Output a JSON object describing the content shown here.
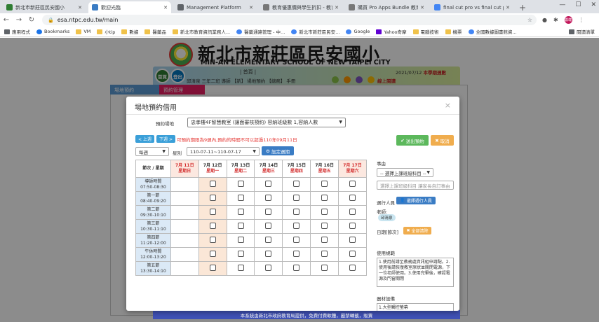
{
  "browser": {
    "tabs": [
      {
        "title": "新北市新莊區民安國小",
        "color": "#2e7d32"
      },
      {
        "title": "歡迎光臨",
        "color": "#3a7cc4",
        "active": true
      },
      {
        "title": "Management Platform",
        "color": "#5f6368"
      },
      {
        "title": "教育優惠價與學生折扣 - 教育...",
        "color": "#777"
      },
      {
        "title": "購買 Pro Apps Bundle 教育...",
        "color": "#777"
      },
      {
        "title": "final cut pro vs final cut pro...",
        "color": "#4285f4"
      }
    ],
    "new_tab": "+",
    "url": "esa.ntpc.edu.tw/main",
    "avatar_text": "雲端",
    "bookmarks": [
      "應用程式",
      "Bookmarks",
      "VM",
      "小tip",
      "數據",
      "醫藥品",
      "新北市教育資訊業務人...",
      "醫藥通路管理 - 中...",
      "新北市新莊區民安...",
      "Google",
      "Yahoo奇摩",
      "電腦技術",
      "機票",
      "全國數據圖書館資..."
    ],
    "bookmarks_right": "閱讀清單"
  },
  "site": {
    "title_zh": "新北市新莊區民安國小",
    "title_en": "MIN-AN ELEMENTARY SCHOOL OF NEW TAIPEI CITY",
    "home_btn": "首頁",
    "logout_btn": "登出",
    "bar_title": "| 首頁 |",
    "date_line": "2021/07/12",
    "date_suffix": "本學期週數",
    "user_line": "邱清泉  三年二班  導師  【新】  場地預約  【總務】  手冊",
    "logout_text": "線上閱讀",
    "footer": "本系統由新北市政府教育局提供，免費付費軟體，嚴禁轉載，販賣",
    "bg_tab1": "場地預約",
    "bg_tab2": "預約管理"
  },
  "modal": {
    "title": "場地預約借用",
    "close": "×",
    "venue_label": "預約場地",
    "venue_value": "忠孝樓4F智慧教室 (讓面審核預約) 容納班級數 1,容納人數",
    "prev": "< 上週",
    "next": "下週 >",
    "warning": "可預約期限為9週內,預約的時間不可以超過110年09月11日",
    "exit_btn": "送出預約",
    "cancel_btn": "取消",
    "cycle_select": "每週",
    "type_label": "星別",
    "range_select": "110-07-11~110-07-17",
    "set_btn": "設定週期",
    "header_period": "節次 / 星期",
    "days": [
      {
        "date": "7月 11日",
        "wd": "星期日"
      },
      {
        "date": "7月 12日",
        "wd": "星期一"
      },
      {
        "date": "7月 13日",
        "wd": "星期二"
      },
      {
        "date": "7月 14日",
        "wd": "星期三"
      },
      {
        "date": "7月 15日",
        "wd": "星期四"
      },
      {
        "date": "7月 16日",
        "wd": "星期五"
      },
      {
        "date": "7月 17日",
        "wd": "星期六"
      }
    ],
    "periods": [
      {
        "name": "導師時間",
        "time": "07:50-08:30"
      },
      {
        "name": "第一節",
        "time": "08:40-09:20"
      },
      {
        "name": "第二節",
        "time": "09:30-10:10"
      },
      {
        "name": "第三節",
        "time": "10:30-11:10"
      },
      {
        "name": "第四節",
        "time": "11:20-12:00"
      },
      {
        "name": "午休時間",
        "time": "12:00-13:20"
      },
      {
        "name": "第五節",
        "time": "13:30-14:10"
      }
    ],
    "reason_label": "事由",
    "reason_select": "-- 選擇上課班級科目 --",
    "reason_placeholder": "選擇上課班級科目 讓家長自訂事由",
    "participants_label": "週行人員",
    "participants_btn": "選擇週行人員",
    "teacher_label": "老師:",
    "teacher_name": "邱清泉",
    "date_label": "日期[節次]",
    "clear_all_btn": "全部清除",
    "rules_label": "使用規範",
    "rules_text": "1.使用前請至教務處資訊組申請配。2.使用後請恢復教室原狀並關閉電源，下一位老師使用。3.使用完畢後，確認電源及門窗關閉",
    "equipment_label": "器材設備",
    "equipment_text": "1.大型觸控螢幕"
  }
}
